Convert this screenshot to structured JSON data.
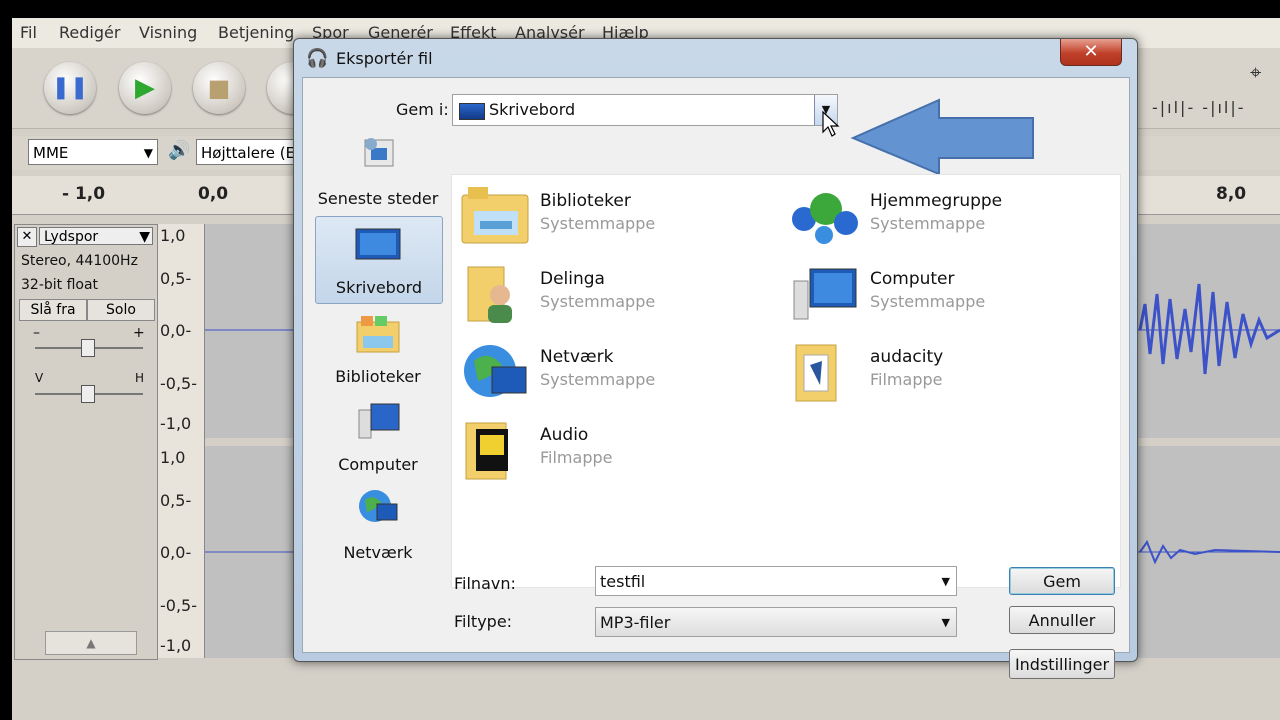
{
  "menubar": [
    "Fil",
    "Redigér",
    "Visning",
    "Betjening",
    "Spor",
    "Generér",
    "Effekt",
    "Analysér",
    "Hjælp"
  ],
  "device": {
    "host": "MME",
    "output": "Højttalere (E"
  },
  "ruler": {
    "left": "- 1,0",
    "zero": "0,0",
    "right": "8,0"
  },
  "track": {
    "name": "Lydspor",
    "info1": "Stereo, 44100Hz",
    "info2": "32-bit float",
    "mute": "Slå fra",
    "solo": "Solo",
    "gain_minus": "–",
    "gain_plus": "+",
    "pan_left": "V",
    "pan_right": "H",
    "close": "✕",
    "collapse": "▲"
  },
  "scale_top": [
    "1,0",
    "0,5-",
    "0,0-",
    "-0,5-",
    "-1,0"
  ],
  "scale_bottom": [
    "1,0",
    "0,5-",
    "0,0-",
    "-0,5-",
    "-1,0"
  ],
  "dialog": {
    "title": "Eksportér fil",
    "close": "✕",
    "save_in_label": "Gem i:",
    "save_in_value": "Skrivebord",
    "places": [
      "Seneste steder",
      "Skrivebord",
      "Biblioteker",
      "Computer",
      "Netværk"
    ],
    "files": [
      {
        "name": "Biblioteker",
        "type": "Systemmappe"
      },
      {
        "name": "Hjemmegruppe",
        "type": "Systemmappe"
      },
      {
        "name": "Delinga",
        "type": "Systemmappe"
      },
      {
        "name": "Computer",
        "type": "Systemmappe"
      },
      {
        "name": "Netværk",
        "type": "Systemmappe"
      },
      {
        "name": "audacity",
        "type": "Filmappe"
      },
      {
        "name": "Audio",
        "type": "Filmappe"
      }
    ],
    "filename_label": "Filnavn:",
    "filename_value": "testfil",
    "filetype_label": "Filtype:",
    "filetype_value": "MP3-filer",
    "save_button": "Gem",
    "cancel_button": "Annuller",
    "options_button": "Indstillinger"
  },
  "colors": {
    "accent_arrow": "#5d8fd0",
    "waveform": "#3c52c8",
    "selection": "#c4d6ea"
  }
}
